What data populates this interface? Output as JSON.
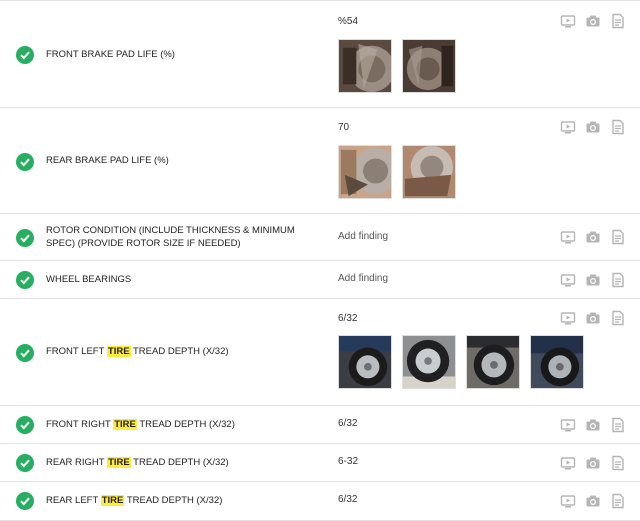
{
  "rows": [
    {
      "status": "ok",
      "label_pre": "FRONT BRAKE PAD LIFE (%)",
      "highlight": "",
      "label_post": "",
      "value": "%54",
      "photos": [
        "brake-photo-front-1",
        "brake-photo-front-2"
      ]
    },
    {
      "status": "ok",
      "label_pre": "REAR BRAKE PAD LIFE (%)",
      "highlight": "",
      "label_post": "",
      "value": "70",
      "photos": [
        "brake-photo-rear-1",
        "brake-photo-rear-2"
      ]
    },
    {
      "status": "ok",
      "label_pre": "ROTOR CONDITION (INCLUDE THICKNESS & MINIMUM SPEC) (PROVIDE ROTOR SIZE IF NEEDED)",
      "highlight": "",
      "label_post": "",
      "value": "Add finding",
      "photos": []
    },
    {
      "status": "ok",
      "label_pre": "WHEEL BEARINGS",
      "highlight": "",
      "label_post": "",
      "value": "Add finding",
      "photos": []
    },
    {
      "status": "ok",
      "label_pre": "FRONT LEFT ",
      "highlight": "TIRE",
      "label_post": " TREAD DEPTH (x/32)",
      "value": "6/32",
      "photos": [
        "tire-photo-1",
        "tire-photo-2",
        "tire-photo-3",
        "tire-photo-4"
      ]
    },
    {
      "status": "ok",
      "label_pre": "FRONT RIGHT ",
      "highlight": "TIRE",
      "label_post": " TREAD DEPTH (x/32)",
      "value": "6/32",
      "photos": []
    },
    {
      "status": "ok",
      "label_pre": "REAR RIGHT ",
      "highlight": "TIRE",
      "label_post": " TREAD DEPTH (x/32)",
      "value": "6-32",
      "photos": []
    },
    {
      "status": "ok",
      "label_pre": "REAR LEFT ",
      "highlight": "TIRE",
      "label_post": " TREAD DEPTH (x/32)",
      "value": "6/32",
      "photos": []
    }
  ],
  "row_icons": [
    "video-icon",
    "camera-icon",
    "note-icon"
  ],
  "colors": {
    "check": "#27ae60",
    "highlight": "#ffeb3b",
    "icon": "#b5b5b5",
    "divider": "#e3e3e3"
  }
}
